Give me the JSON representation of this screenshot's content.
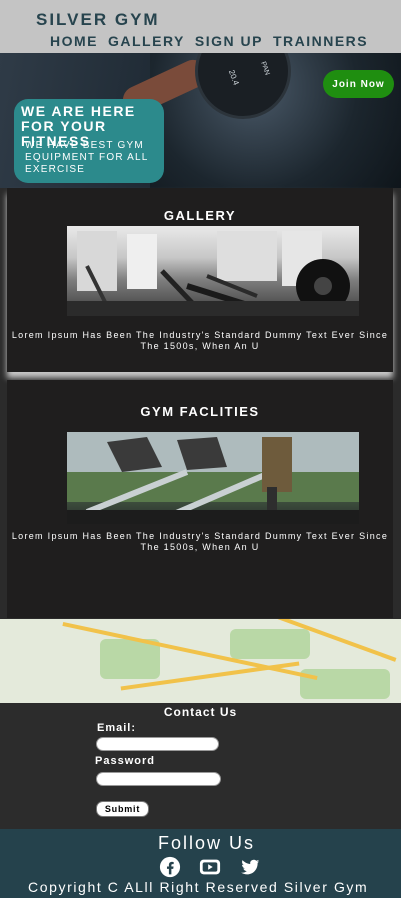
{
  "header": {
    "brand": "SILVER GYM",
    "nav": [
      "HOME",
      "GALLERY",
      "SIGN UP",
      "TRAINNERS"
    ]
  },
  "hero": {
    "title": "WE ARE HERE FOR YOUR FITNESS",
    "subtitle": "WE HAVE BEST GYM EQUIPMENT FOR ALL EXERCISE",
    "join_label": "Join Now",
    "plate_text": "20.4",
    "plate_text2": "PAN"
  },
  "sections": [
    {
      "title": "GALLERY",
      "text": "Lorem Ipsum Has Been The Industry's Standard Dummy Text Ever Since The 1500s, When An U"
    },
    {
      "title": "GYM FACLITIES",
      "text": "Lorem Ipsum Has Been The Industry's Standard Dummy Text Ever Since The 1500s, When An U"
    }
  ],
  "contact": {
    "title": "Contact Us",
    "email_label": "Email:",
    "password_label": "Password",
    "submit_label": "Submit"
  },
  "footer": {
    "follow": "Follow Us",
    "socials": [
      "facebook-icon",
      "youtube-icon",
      "twitter-icon"
    ],
    "copyright": "Copyright C ALll Right Reserved Silver Gym"
  },
  "colors": {
    "header_bg": "#c4c4c4",
    "brand_text": "#27444e",
    "hero_box": "#2c8a8c",
    "join_button": "#1f8e10",
    "card_bg": "#1f1e1e",
    "footer_bg": "#25424c"
  }
}
